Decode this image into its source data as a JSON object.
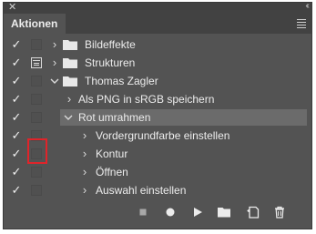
{
  "window": {
    "close_icon": "close-icon",
    "collapse_icon": "collapse-arrows-icon"
  },
  "panel": {
    "tab_title": "Aktionen",
    "menu_icon": "hamburger-menu-icon"
  },
  "rows": [
    {
      "label": "Bildeffekte",
      "checked": true,
      "dialog": false,
      "indent": 0,
      "expanded": false,
      "type": "set"
    },
    {
      "label": "Strukturen",
      "checked": true,
      "dialog": true,
      "indent": 0,
      "expanded": false,
      "type": "set"
    },
    {
      "label": "Thomas Zagler",
      "checked": true,
      "dialog": false,
      "indent": 0,
      "expanded": true,
      "type": "set"
    },
    {
      "label": "Als PNG in sRGB speichern",
      "checked": true,
      "dialog": false,
      "indent": 1,
      "expanded": false,
      "type": "action"
    },
    {
      "label": "Rot umrahmen",
      "checked": true,
      "dialog": false,
      "indent": 1,
      "expanded": true,
      "type": "action",
      "selected": true
    },
    {
      "label": "Vordergrundfarbe einstellen",
      "checked": true,
      "dialog": false,
      "indent": 2,
      "expanded": false,
      "type": "step"
    },
    {
      "label": "Kontur",
      "checked": true,
      "dialog": false,
      "indent": 2,
      "expanded": false,
      "type": "step",
      "dialog_highlighted": true
    },
    {
      "label": "Öffnen",
      "checked": true,
      "dialog": false,
      "indent": 2,
      "expanded": false,
      "type": "step"
    },
    {
      "label": "Auswahl einstellen",
      "checked": true,
      "dialog": false,
      "indent": 2,
      "expanded": false,
      "type": "step"
    }
  ],
  "toolbar": {
    "stop_icon": "stop-icon",
    "record_icon": "record-icon",
    "play_icon": "play-icon",
    "new_set_icon": "folder-icon",
    "new_action_icon": "new-item-icon",
    "delete_icon": "trash-icon"
  },
  "colors": {
    "panel_bg": "#535353",
    "selected_row": "#6b6b6b",
    "text": "#ececec",
    "highlight_frame": "#e0242a"
  }
}
